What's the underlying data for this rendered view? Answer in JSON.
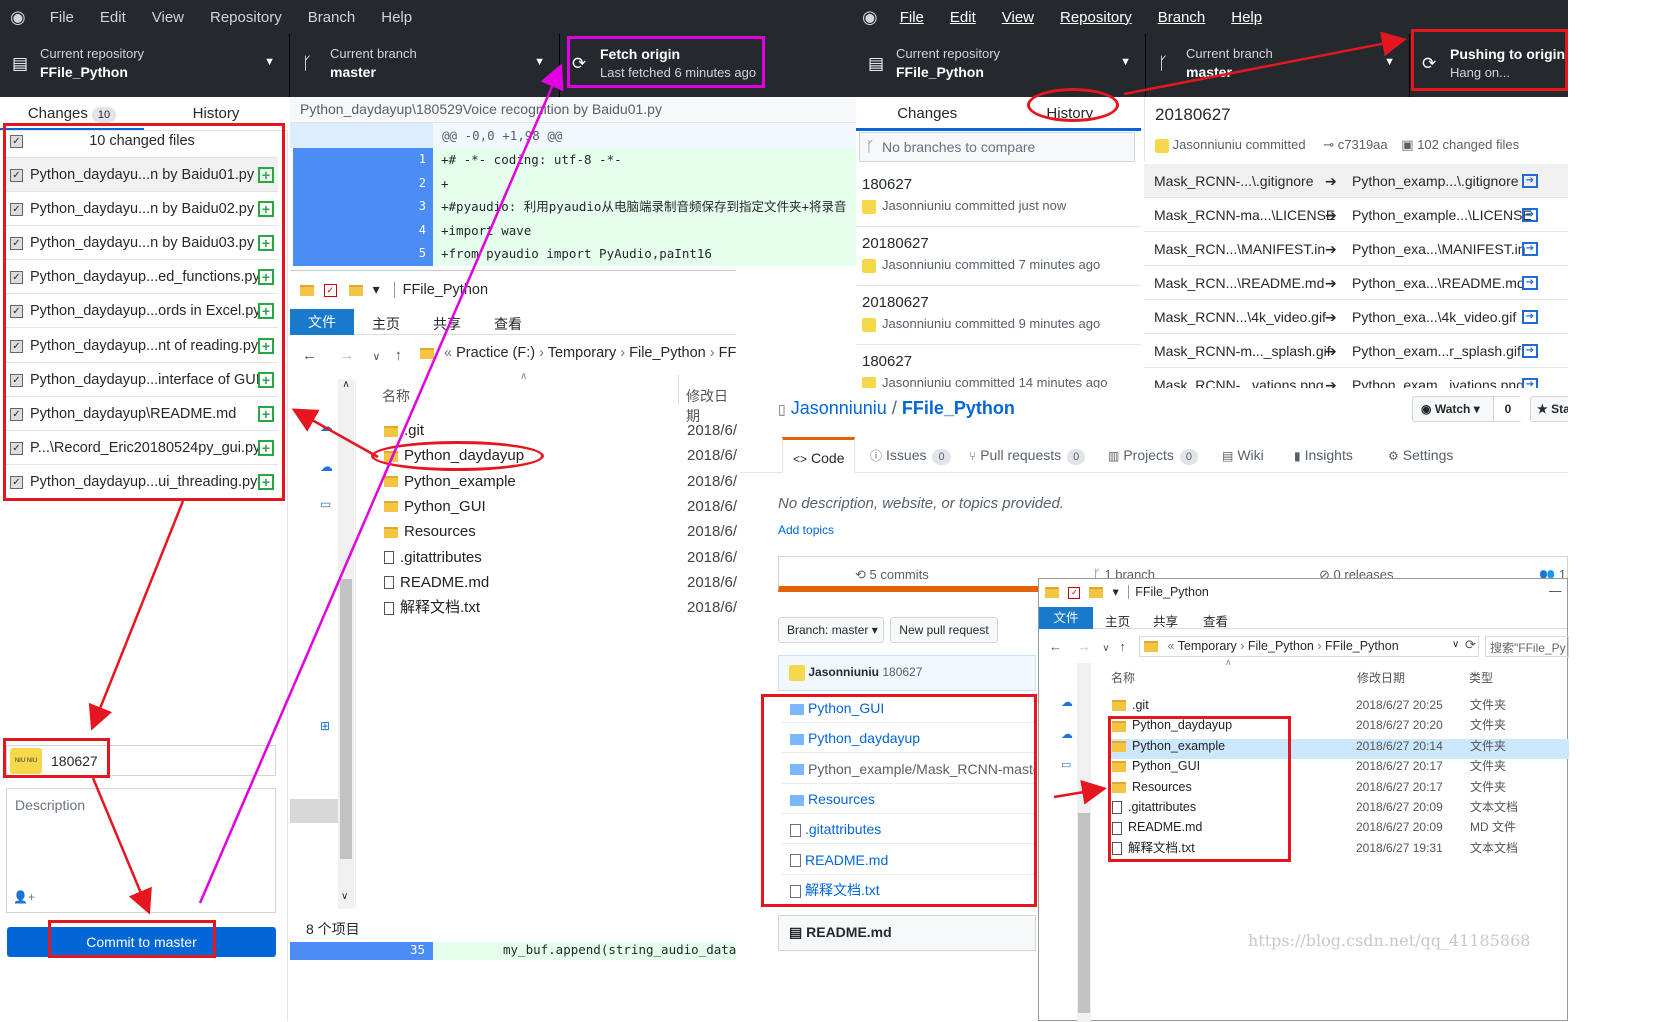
{
  "left_app": {
    "menu": [
      "File",
      "Edit",
      "View",
      "Repository",
      "Branch",
      "Help"
    ],
    "repo": {
      "label": "Current repository",
      "value": "FFile_Python"
    },
    "branch": {
      "label": "Current branch",
      "value": "master"
    },
    "fetch": {
      "label": "Fetch origin",
      "sub": "Last fetched 6 minutes ago"
    },
    "tabs": {
      "changes": "Changes",
      "changes_count": "10",
      "history": "History"
    },
    "changed_files_header": "10 changed files",
    "files": [
      "Python_daydayu...n by Baidu01.py",
      "Python_daydayu...n by Baidu02.py",
      "Python_daydayu...n by Baidu03.py",
      "Python_daydayup...ed_functions.py",
      "Python_daydayup...ords in Excel.py",
      "Python_daydayup...nt of reading.py",
      "Python_daydayup...interface of GUI",
      "Python_daydayup\\README.md",
      "P...\\Record_Eric20180524py_gui.py",
      "Python_daydayup...ui_threading.py"
    ],
    "summary_value": "180627",
    "description_placeholder": "Description",
    "commit_button": "Commit to master",
    "avatar_text": "NIU NIU"
  },
  "diff": {
    "path": "Python_daydayup\\180529Voice recognition by Baidu01.py",
    "hunk": "@@ -0,0 +1,98 @@",
    "lines": [
      {
        "n": "1",
        "text": "+# -*- coding: utf-8 -*-"
      },
      {
        "n": "2",
        "text": "+"
      },
      {
        "n": "3",
        "text": "+#pyaudio: 利用pyaudio从电脑端录制音频保存到指定文件夹+将录音"
      },
      {
        "n": "4",
        "text": "+import wave"
      },
      {
        "n": "5",
        "text": "+from pyaudio import PyAudio,paInt16"
      }
    ],
    "bottom_line": {
      "n": "35",
      "text": "my_buf.append(string_audio_data)"
    }
  },
  "explorer_left": {
    "title": "FFile_Python",
    "ribbon": [
      "文件",
      "主页",
      "共享",
      "查看"
    ],
    "address": [
      "Practice (F:)",
      "Temporary",
      "File_Python",
      "FFile_Python"
    ],
    "col_name": "名称",
    "col_date": "修改日期",
    "items": [
      {
        "name": ".git",
        "date": "2018/6/",
        "type": "folder"
      },
      {
        "name": "Python_daydayup",
        "date": "2018/6/",
        "type": "folder"
      },
      {
        "name": "Python_example",
        "date": "2018/6/",
        "type": "folder"
      },
      {
        "name": "Python_GUI",
        "date": "2018/6/",
        "type": "folder"
      },
      {
        "name": "Resources",
        "date": "2018/6/",
        "type": "folder"
      },
      {
        "name": ".gitattributes",
        "date": "2018/6/",
        "type": "file"
      },
      {
        "name": "README.md",
        "date": "2018/6/",
        "type": "file"
      },
      {
        "name": "解释文档.txt",
        "date": "2018/6/",
        "type": "file"
      }
    ],
    "status": "8 个项目"
  },
  "right_app": {
    "menu": [
      "File",
      "Edit",
      "View",
      "Repository",
      "Branch",
      "Help"
    ],
    "repo": {
      "label": "Current repository",
      "value": "FFile_Python"
    },
    "branch": {
      "label": "Current branch",
      "value": "master"
    },
    "push": {
      "label": "Pushing to origin",
      "sub": "Hang on..."
    },
    "tabs": {
      "changes": "Changes",
      "history": "History"
    },
    "compare": "No branches to compare",
    "history": [
      {
        "title": "180627",
        "sub": "Jasonniuniu committed just now"
      },
      {
        "title": "20180627",
        "sub": "Jasonniuniu committed 7 minutes ago"
      },
      {
        "title": "20180627",
        "sub": "Jasonniuniu committed 9 minutes ago"
      },
      {
        "title": "180627",
        "sub": "Jasonniuniu committed 14 minutes ago"
      }
    ],
    "commit_title": "20180627",
    "commit_author": "Jasonniuniu committed",
    "commit_sha": "c7319aa",
    "commit_files": "102 changed files",
    "renames": [
      {
        "from": "Mask_RCNN-...\\.gitignore",
        "to": "Python_examp...\\.gitignore"
      },
      {
        "from": "Mask_RCNN-ma...\\LICENSE",
        "to": "Python_example...\\LICENSE"
      },
      {
        "from": "Mask_RCN...\\MANIFEST.in",
        "to": "Python_exa...\\MANIFEST.in"
      },
      {
        "from": "Mask_RCN...\\README.md",
        "to": "Python_exa...\\README.md"
      },
      {
        "from": "Mask_RCNN...\\4k_video.gif",
        "to": "Python_exa...\\4k_video.gif"
      },
      {
        "from": "Mask_RCNN-m..._splash.gif",
        "to": "Python_exam...r_splash.gif"
      },
      {
        "from": "Mask_RCNN-...vations.png",
        "to": "Python_exam...ivations.png"
      }
    ]
  },
  "github": {
    "owner": "Jasonniuniu",
    "repo": "FFile_Python",
    "watch": "Watch",
    "watch_count": "0",
    "star": "Sta",
    "tabs": [
      {
        "label": "Code",
        "count": ""
      },
      {
        "label": "Issues",
        "count": "0"
      },
      {
        "label": "Pull requests",
        "count": "0"
      },
      {
        "label": "Projects",
        "count": "0"
      },
      {
        "label": "Wiki",
        "count": ""
      },
      {
        "label": "Insights",
        "count": ""
      },
      {
        "label": "Settings",
        "count": ""
      }
    ],
    "description": "No description, website, or topics provided.",
    "add_topics": "Add topics",
    "commits": "5 commits",
    "branches": "1 branch",
    "releases": "0 releases",
    "contrib": "1",
    "branch_btn": "Branch: master",
    "new_pr": "New pull request",
    "latest_commit": {
      "author": "Jasonniuniu",
      "msg": "180627"
    },
    "files": [
      {
        "name": "Python_GUI",
        "type": "folder"
      },
      {
        "name": "Python_daydayup",
        "type": "folder"
      },
      {
        "name": "Python_example/Mask_RCNN-master",
        "type": "folder",
        "prefix": "Python_example/"
      },
      {
        "name": "Resources",
        "type": "folder"
      },
      {
        "name": ".gitattributes",
        "type": "file"
      },
      {
        "name": "README.md",
        "type": "file"
      },
      {
        "name": "解释文档.txt",
        "type": "file"
      }
    ],
    "readme": "README.md"
  },
  "explorer_right": {
    "title": "FFile_Python",
    "ribbon": [
      "文件",
      "主页",
      "共享",
      "查看"
    ],
    "address": [
      "Temporary",
      "File_Python",
      "FFile_Python"
    ],
    "search": "搜索\"FFile_Py",
    "cols": [
      "名称",
      "修改日期",
      "类型"
    ],
    "items": [
      {
        "name": ".git",
        "date": "2018/6/27 20:25",
        "type": "文件夹"
      },
      {
        "name": "Python_daydayup",
        "date": "2018/6/27 20:20",
        "type": "文件夹"
      },
      {
        "name": "Python_example",
        "date": "2018/6/27 20:14",
        "type": "文件夹"
      },
      {
        "name": "Python_GUI",
        "date": "2018/6/27 20:17",
        "type": "文件夹"
      },
      {
        "name": "Resources",
        "date": "2018/6/27 20:17",
        "type": "文件夹"
      },
      {
        "name": ".gitattributes",
        "date": "2018/6/27 20:09",
        "type": "文本文档"
      },
      {
        "name": "README.md",
        "date": "2018/6/27 20:09",
        "type": "MD 文件"
      },
      {
        "name": "解释文档.txt",
        "date": "2018/6/27 19:31",
        "type": "文本文档"
      }
    ]
  },
  "watermark": "https://blog.csdn.net/qq_41185868"
}
